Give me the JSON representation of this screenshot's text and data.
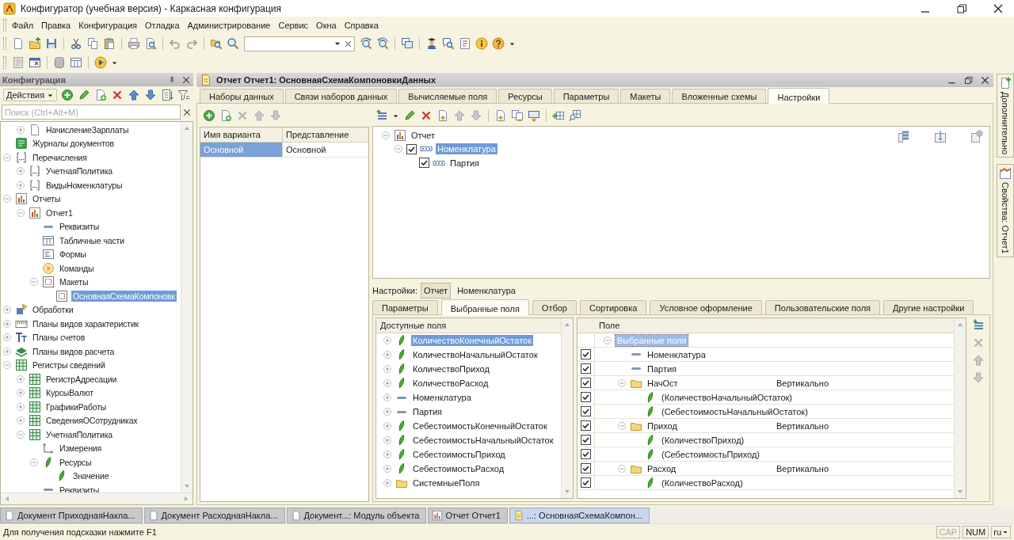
{
  "window": {
    "title": "Конфигуратор (учебная версия) - Каркасная конфигурация"
  },
  "menu": [
    "Файл",
    "Правка",
    "Конфигурация",
    "Отладка",
    "Администрирование",
    "Сервис",
    "Окна",
    "Справка"
  ],
  "config_panel": {
    "title": "Конфигурация",
    "actions_label": "Действия",
    "search": {
      "placeholder": "Поиск (Ctrl+Alt+M)"
    },
    "tree": [
      {
        "children": [
          {
            "label": "НачислениеЗарплаты",
            "kind": "document",
            "expanded": false,
            "selected": false
          }
        ]
      },
      {
        "label": "Журналы документов",
        "kind": "journal",
        "selected": false
      },
      {
        "label": "Перечисления",
        "kind": "enum",
        "expanded": true,
        "selected": false,
        "children": [
          {
            "label": "УчетнаяПолитика",
            "kind": "enum",
            "expanded": false,
            "selected": false
          },
          {
            "label": "ВидыНоменклатуры",
            "kind": "enum",
            "expanded": false,
            "selected": false
          }
        ]
      },
      {
        "label": "Отчеты",
        "kind": "report",
        "expanded": true,
        "selected": false,
        "children": [
          {
            "label": "Отчет1",
            "kind": "report",
            "expanded": true,
            "selected": false,
            "children": [
              {
                "label": "Реквизиты",
                "kind": "attribute",
                "selected": false
              },
              {
                "label": "Табличные части",
                "kind": "tabular",
                "selected": false
              },
              {
                "label": "Формы",
                "kind": "form",
                "selected": false
              },
              {
                "label": "Команды",
                "kind": "command",
                "selected": false
              },
              {
                "label": "Макеты",
                "kind": "template",
                "expanded": true,
                "selected": false,
                "children": [
                  {
                    "label": "ОсновнаяСхемаКомпоновк",
                    "kind": "template",
                    "selected": true
                  }
                ]
              }
            ]
          }
        ]
      },
      {
        "label": "Обработки",
        "kind": "processing",
        "expanded": false,
        "selected": false
      },
      {
        "label": "Планы видов характеристик",
        "kind": "characteristic_types",
        "expanded": false,
        "selected": false
      },
      {
        "label": "Планы счетов",
        "kind": "accounts",
        "expanded": false,
        "selected": false
      },
      {
        "label": "Планы видов расчета",
        "kind": "calculation_types",
        "expanded": false,
        "selected": false
      },
      {
        "label": "Регистры сведений",
        "kind": "register",
        "expanded": true,
        "selected": false,
        "children": [
          {
            "label": "РегистрАдресации",
            "kind": "register",
            "expanded": false,
            "selected": false
          },
          {
            "label": "КурсыВалют",
            "kind": "register",
            "expanded": false,
            "selected": false
          },
          {
            "label": "ГрафикиРаботы",
            "kind": "register",
            "expanded": false,
            "selected": false
          },
          {
            "label": "СведенияОСотрудниках",
            "kind": "register",
            "expanded": false,
            "selected": false
          },
          {
            "label": "УчетнаяПолитика",
            "kind": "register",
            "expanded": true,
            "selected": false,
            "children": [
              {
                "label": "Измерения",
                "kind": "dimension",
                "selected": false
              },
              {
                "label": "Ресурсы",
                "kind": "resource",
                "expanded": true,
                "selected": false,
                "children": [
                  {
                    "label": "Значение",
                    "kind": "resource",
                    "selected": false
                  }
                ]
              },
              {
                "label": "Реквизиты",
                "kind": "attribute",
                "selected": false
              }
            ]
          }
        ]
      }
    ]
  },
  "editor": {
    "title": "Отчет Отчет1: ОсновнаяСхемаКомпоновкиДанных",
    "tabs": [
      {
        "label": "Наборы данных",
        "selected": false
      },
      {
        "label": "Связи наборов данных",
        "selected": false
      },
      {
        "label": "Вычисляемые поля",
        "selected": false
      },
      {
        "label": "Ресурсы",
        "selected": false
      },
      {
        "label": "Параметры",
        "selected": false
      },
      {
        "label": "Макеты",
        "selected": false
      },
      {
        "label": "Вложенные схемы",
        "selected": false
      },
      {
        "label": "Настройки",
        "selected": true
      }
    ],
    "variants": {
      "columns": [
        "Имя варианта",
        "Представление"
      ],
      "rows": [
        {
          "cells": [
            "Основной",
            "Основной"
          ],
          "selected": true
        }
      ]
    },
    "structure": [
      {
        "label": "Отчет",
        "kind": "report",
        "expanded": true,
        "selected": false,
        "children": [
          {
            "label": "Номенклатура",
            "kind": "grouping",
            "checked": true,
            "expanded": true,
            "selected": true,
            "children": [
              {
                "label": "Партия",
                "kind": "grouping",
                "checked": true,
                "selected": false
              }
            ]
          }
        ]
      }
    ],
    "settings_label": "Настройки:",
    "settings_path": [
      {
        "label": "Отчет",
        "selected": true
      },
      {
        "label": "Номенклатура",
        "selected": false
      }
    ],
    "settings_tabs": [
      {
        "label": "Параметры",
        "selected": false
      },
      {
        "label": "Выбранные поля",
        "selected": true
      },
      {
        "label": "Отбор",
        "selected": false
      },
      {
        "label": "Сортировка",
        "selected": false
      },
      {
        "label": "Условное оформление",
        "selected": false
      },
      {
        "label": "Пользовательские поля",
        "selected": false
      },
      {
        "label": "Другие настройки",
        "selected": false
      }
    ],
    "available_fields": {
      "title": "Доступные поля",
      "items": [
        {
          "label": "КоличествоКонечныйОстаток",
          "kind": "resource",
          "expanded": false,
          "selected": true
        },
        {
          "label": "КоличествоНачальныйОстаток",
          "kind": "resource",
          "expanded": false,
          "selected": false
        },
        {
          "label": "КоличествоПриход",
          "kind": "resource",
          "expanded": false,
          "selected": false
        },
        {
          "label": "КоличествоРасход",
          "kind": "resource",
          "expanded": false,
          "selected": false
        },
        {
          "label": "Номенклатура",
          "kind": "attribute",
          "expanded": false,
          "selected": false
        },
        {
          "label": "Партия",
          "kind": "attribute",
          "expanded": false,
          "selected": false
        },
        {
          "label": "СебестоимостьКонечныйОстаток",
          "kind": "resource",
          "expanded": false,
          "selected": false
        },
        {
          "label": "СебестоимостьНачальныйОстаток",
          "kind": "resource",
          "expanded": false,
          "selected": false
        },
        {
          "label": "СебестоимостьПриход",
          "kind": "resource",
          "expanded": false,
          "selected": false
        },
        {
          "label": "СебестоимостьРасход",
          "kind": "resource",
          "expanded": false,
          "selected": false
        },
        {
          "label": "СистемныеПоля",
          "kind": "folder",
          "expanded": false,
          "selected": false
        }
      ]
    },
    "selected_fields": {
      "column": "Поле",
      "rows": [
        {
          "label": "Выбранные поля",
          "expanded": true,
          "selected": true,
          "children": [
            {
              "label": "Номенклатура",
              "kind": "attribute",
              "checked": true,
              "selected": false
            },
            {
              "label": "Партия",
              "kind": "attribute",
              "checked": true,
              "selected": false
            },
            {
              "label": "НачОст",
              "kind": "folder",
              "checked": true,
              "expanded": true,
              "placement": "Вертикально",
              "selected": false,
              "children": [
                {
                  "label": "(КоличествоНачальныйОстаток)",
                  "kind": "resource",
                  "checked": true,
                  "selected": false
                },
                {
                  "label": "(СебестоимостьНачальныйОстаток)",
                  "kind": "resource",
                  "checked": true,
                  "selected": false
                }
              ]
            },
            {
              "label": "Приход",
              "kind": "folder",
              "checked": true,
              "expanded": true,
              "placement": "Вертикально",
              "selected": false,
              "children": [
                {
                  "label": "(КоличествоПриход)",
                  "kind": "resource",
                  "checked": true,
                  "selected": false
                },
                {
                  "label": "(СебестоимостьПриход)",
                  "kind": "resource",
                  "checked": true,
                  "selected": false
                }
              ]
            },
            {
              "label": "Расход",
              "kind": "folder",
              "checked": true,
              "expanded": true,
              "placement": "Вертикально",
              "selected": false,
              "children": [
                {
                  "label": "(КоличествоРасход)",
                  "kind": "resource",
                  "checked": true,
                  "selected": false
                }
              ]
            }
          ]
        }
      ]
    }
  },
  "side_tabs": [
    {
      "label": "Дополнительно",
      "kind": "additional"
    },
    {
      "label": "Свойства: Отчет1",
      "kind": "properties"
    }
  ],
  "taskbar": [
    {
      "label": "Документ ПриходнаяНакла...",
      "kind": "document",
      "selected": false
    },
    {
      "label": "Документ РасходнаяНакла...",
      "kind": "document",
      "selected": false
    },
    {
      "label": "Документ...: Модуль объекта",
      "kind": "document",
      "selected": false
    },
    {
      "label": "Отчет Отчет1",
      "kind": "report",
      "selected": false
    },
    {
      "label": "...: ОсновнаяСхемаКомпон...",
      "kind": "schema",
      "selected": true
    }
  ],
  "status_bar": {
    "hint": "Для получения подсказки нажмите F1",
    "indicators": [
      {
        "label": "CAP",
        "on": false
      },
      {
        "label": "NUM",
        "on": true
      }
    ],
    "language": "ru"
  }
}
